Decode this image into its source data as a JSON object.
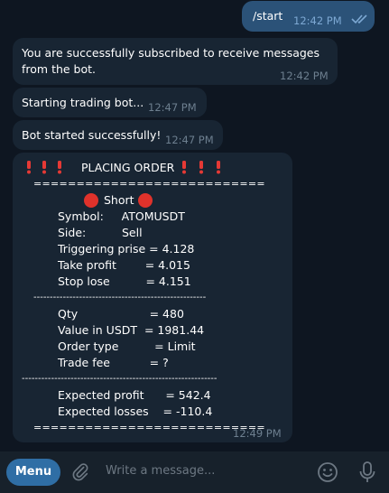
{
  "messages": {
    "outgoing": {
      "text": "/start",
      "time": "12:42 PM"
    },
    "sub": {
      "line1": "You are successfully subscribed to receive messages",
      "line2": "from the bot.",
      "time": "12:42 PM"
    },
    "starting": {
      "text": "Starting trading bot...",
      "time": "12:47 PM"
    },
    "started": {
      "text": "Bot started successfully!",
      "time": "12:47 PM"
    },
    "order": {
      "title": "PLACING ORDER",
      "sep_eq": "===========================",
      "short_label": "Short",
      "symbol": "Symbol:     ATOMUSDT",
      "side": "Side:          Sell",
      "trigger": "Triggering prise = 4.128",
      "tp": "Take profit        = 4.015",
      "sl": "Stop lose          = 4.151",
      "sep_dash_long": "-----------------------------------------------------",
      "qty": "Qty                    = 480",
      "value": "Value in USDT  = 1981.44",
      "otype": "Order type          = Limit",
      "fee": "Trade fee           = ?",
      "sep_dash_2": "------------------------------------------------------------",
      "exp_profit": "Expected profit      = 542.4",
      "exp_loss": "Expected losses    = -110.4",
      "sep_eq_end": "===========================",
      "time": "12:49 PM"
    }
  },
  "composer": {
    "menu_label": "Menu",
    "placeholder": "Write a message..."
  },
  "colors": {
    "background": "#0e1621",
    "incoming_bubble": "#182533",
    "outgoing_bubble": "#2b5278",
    "accent": "#2f6ea5",
    "exclamation": "#e53935",
    "red_circle": "#e0322b"
  },
  "icons": [
    "double-check-icon",
    "exclamation-icon",
    "red-circle-icon",
    "paperclip-icon",
    "emoji-icon",
    "microphone-icon"
  ]
}
